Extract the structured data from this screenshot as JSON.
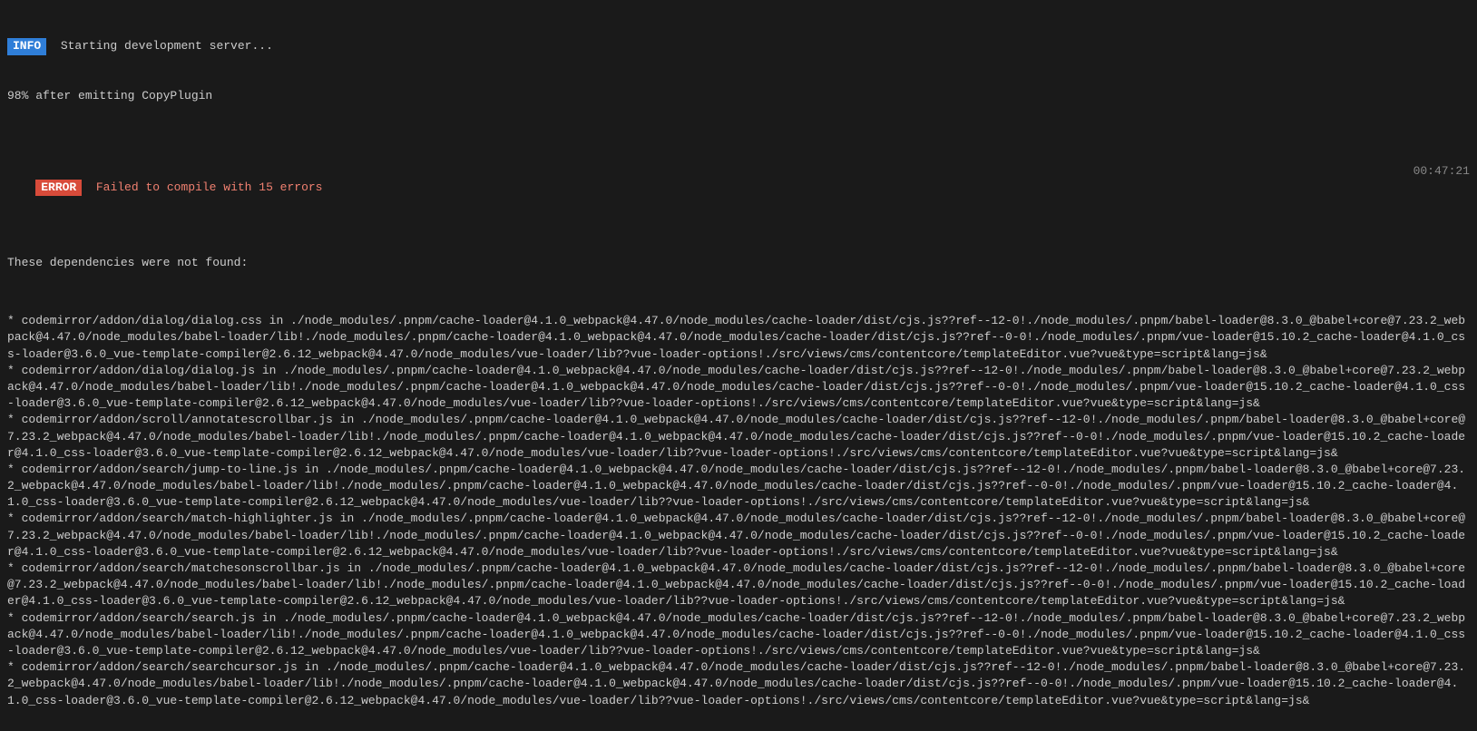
{
  "info": {
    "badge": "INFO",
    "text": "Starting development server...",
    "progress": "98% after emitting CopyPlugin"
  },
  "error": {
    "badge": "ERROR",
    "text": "Failed to compile with 15 errors",
    "timestamp": "00:47:21"
  },
  "deps_header": "These dependencies were not found:",
  "deps": [
    "* codemirror/addon/dialog/dialog.css in ./node_modules/.pnpm/cache-loader@4.1.0_webpack@4.47.0/node_modules/cache-loader/dist/cjs.js??ref--12-0!./node_modules/.pnpm/babel-loader@8.3.0_@babel+core@7.23.2_webpack@4.47.0/node_modules/babel-loader/lib!./node_modules/.pnpm/cache-loader@4.1.0_webpack@4.47.0/node_modules/cache-loader/dist/cjs.js??ref--0-0!./node_modules/.pnpm/vue-loader@15.10.2_cache-loader@4.1.0_css-loader@3.6.0_vue-template-compiler@2.6.12_webpack@4.47.0/node_modules/vue-loader/lib??vue-loader-options!./src/views/cms/contentcore/templateEditor.vue?vue&type=script&lang=js&",
    "* codemirror/addon/dialog/dialog.js in ./node_modules/.pnpm/cache-loader@4.1.0_webpack@4.47.0/node_modules/cache-loader/dist/cjs.js??ref--12-0!./node_modules/.pnpm/babel-loader@8.3.0_@babel+core@7.23.2_webpack@4.47.0/node_modules/babel-loader/lib!./node_modules/.pnpm/cache-loader@4.1.0_webpack@4.47.0/node_modules/cache-loader/dist/cjs.js??ref--0-0!./node_modules/.pnpm/vue-loader@15.10.2_cache-loader@4.1.0_css-loader@3.6.0_vue-template-compiler@2.6.12_webpack@4.47.0/node_modules/vue-loader/lib??vue-loader-options!./src/views/cms/contentcore/templateEditor.vue?vue&type=script&lang=js&",
    "* codemirror/addon/scroll/annotatescrollbar.js in ./node_modules/.pnpm/cache-loader@4.1.0_webpack@4.47.0/node_modules/cache-loader/dist/cjs.js??ref--12-0!./node_modules/.pnpm/babel-loader@8.3.0_@babel+core@7.23.2_webpack@4.47.0/node_modules/babel-loader/lib!./node_modules/.pnpm/cache-loader@4.1.0_webpack@4.47.0/node_modules/cache-loader/dist/cjs.js??ref--0-0!./node_modules/.pnpm/vue-loader@15.10.2_cache-loader@4.1.0_css-loader@3.6.0_vue-template-compiler@2.6.12_webpack@4.47.0/node_modules/vue-loader/lib??vue-loader-options!./src/views/cms/contentcore/templateEditor.vue?vue&type=script&lang=js&",
    "* codemirror/addon/search/jump-to-line.js in ./node_modules/.pnpm/cache-loader@4.1.0_webpack@4.47.0/node_modules/cache-loader/dist/cjs.js??ref--12-0!./node_modules/.pnpm/babel-loader@8.3.0_@babel+core@7.23.2_webpack@4.47.0/node_modules/babel-loader/lib!./node_modules/.pnpm/cache-loader@4.1.0_webpack@4.47.0/node_modules/cache-loader/dist/cjs.js??ref--0-0!./node_modules/.pnpm/vue-loader@15.10.2_cache-loader@4.1.0_css-loader@3.6.0_vue-template-compiler@2.6.12_webpack@4.47.0/node_modules/vue-loader/lib??vue-loader-options!./src/views/cms/contentcore/templateEditor.vue?vue&type=script&lang=js&",
    "* codemirror/addon/search/match-highlighter.js in ./node_modules/.pnpm/cache-loader@4.1.0_webpack@4.47.0/node_modules/cache-loader/dist/cjs.js??ref--12-0!./node_modules/.pnpm/babel-loader@8.3.0_@babel+core@7.23.2_webpack@4.47.0/node_modules/babel-loader/lib!./node_modules/.pnpm/cache-loader@4.1.0_webpack@4.47.0/node_modules/cache-loader/dist/cjs.js??ref--0-0!./node_modules/.pnpm/vue-loader@15.10.2_cache-loader@4.1.0_css-loader@3.6.0_vue-template-compiler@2.6.12_webpack@4.47.0/node_modules/vue-loader/lib??vue-loader-options!./src/views/cms/contentcore/templateEditor.vue?vue&type=script&lang=js&",
    "* codemirror/addon/search/matchesonscrollbar.js in ./node_modules/.pnpm/cache-loader@4.1.0_webpack@4.47.0/node_modules/cache-loader/dist/cjs.js??ref--12-0!./node_modules/.pnpm/babel-loader@8.3.0_@babel+core@7.23.2_webpack@4.47.0/node_modules/babel-loader/lib!./node_modules/.pnpm/cache-loader@4.1.0_webpack@4.47.0/node_modules/cache-loader/dist/cjs.js??ref--0-0!./node_modules/.pnpm/vue-loader@15.10.2_cache-loader@4.1.0_css-loader@3.6.0_vue-template-compiler@2.6.12_webpack@4.47.0/node_modules/vue-loader/lib??vue-loader-options!./src/views/cms/contentcore/templateEditor.vue?vue&type=script&lang=js&",
    "* codemirror/addon/search/search.js in ./node_modules/.pnpm/cache-loader@4.1.0_webpack@4.47.0/node_modules/cache-loader/dist/cjs.js??ref--12-0!./node_modules/.pnpm/babel-loader@8.3.0_@babel+core@7.23.2_webpack@4.47.0/node_modules/babel-loader/lib!./node_modules/.pnpm/cache-loader@4.1.0_webpack@4.47.0/node_modules/cache-loader/dist/cjs.js??ref--0-0!./node_modules/.pnpm/vue-loader@15.10.2_cache-loader@4.1.0_css-loader@3.6.0_vue-template-compiler@2.6.12_webpack@4.47.0/node_modules/vue-loader/lib??vue-loader-options!./src/views/cms/contentcore/templateEditor.vue?vue&type=script&lang=js&",
    "* codemirror/addon/search/searchcursor.js in ./node_modules/.pnpm/cache-loader@4.1.0_webpack@4.47.0/node_modules/cache-loader/dist/cjs.js??ref--12-0!./node_modules/.pnpm/babel-loader@8.3.0_@babel+core@7.23.2_webpack@4.47.0/node_modules/babel-loader/lib!./node_modules/.pnpm/cache-loader@4.1.0_webpack@4.47.0/node_modules/cache-loader/dist/cjs.js??ref--0-0!./node_modules/.pnpm/vue-loader@15.10.2_cache-loader@4.1.0_css-loader@3.6.0_vue-template-compiler@2.6.12_webpack@4.47.0/node_modules/vue-loader/lib??vue-loader-options!./src/views/cms/contentcore/templateEditor.vue?vue&type=script&lang=js&"
  ]
}
